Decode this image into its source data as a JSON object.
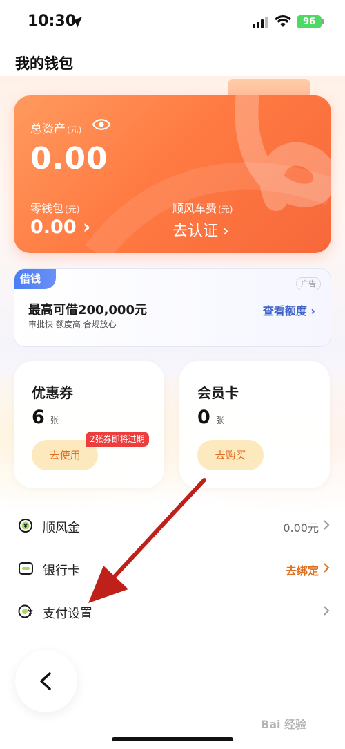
{
  "status_bar": {
    "time": "10:30",
    "battery": "96"
  },
  "header": {
    "title": "我的钱包"
  },
  "asset_card": {
    "total_label": "总资产",
    "unit": "(元)",
    "total_value": "0.00",
    "wallet_label": "零钱包",
    "wallet_value": "0.00 ›",
    "fare_label": "顺风车费",
    "fare_value": "去认证 ›"
  },
  "borrow": {
    "tag": "借钱",
    "ad": "广告",
    "title": "最高可借200,000元",
    "subtitle": "审批快 额度高 合规放心",
    "link": "查看额度 ›"
  },
  "coupon": {
    "title": "优惠券",
    "count": "6",
    "unit": "张",
    "badge": "2张券即将过期",
    "button": "去使用"
  },
  "member": {
    "title": "会员卡",
    "count": "0",
    "unit": "张",
    "button": "去购买"
  },
  "list": [
    {
      "label": "顺风金",
      "value": "0.00元"
    },
    {
      "label": "银行卡",
      "value": "去绑定"
    },
    {
      "label": "支付设置",
      "value": ""
    }
  ],
  "watermark": "Bai 经验",
  "colors": {
    "accent": "#ff7b43",
    "link_blue": "#3d63c8",
    "badge_red": "#ee3d3d",
    "arrow_red": "#c0201a"
  }
}
